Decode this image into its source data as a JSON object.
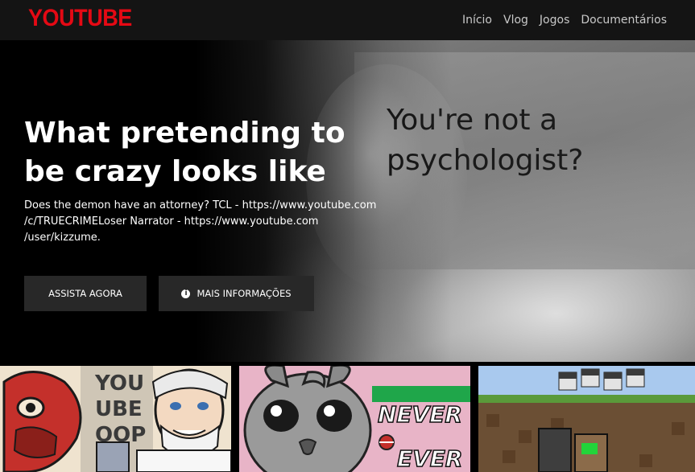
{
  "brand": {
    "logo": "YOUTUBE",
    "color": "#e50914"
  },
  "nav": {
    "links": [
      {
        "label": "Início"
      },
      {
        "label": "Vlog"
      },
      {
        "label": "Jogos"
      },
      {
        "label": "Documentários"
      }
    ]
  },
  "hero": {
    "title": "What pretending to be crazy looks like",
    "description": "Does the demon have an attorney? TCL - https://www.youtube.com\n/c/TRUECRIMELoser Narrator - https://www.youtube.com\n/user/kizzume.",
    "image_caption": "You're not a\npsychologist?",
    "watch_label": "ASSISTA AGORA",
    "info_label": "MAIS INFORMAÇÕES",
    "info_icon": "info-circle-icon"
  },
  "thumbnails": [
    {
      "text_lines": [
        "YOU",
        "UBE",
        "OOP"
      ]
    },
    {
      "text_lines": [
        "NEVER",
        "EVER"
      ]
    },
    {
      "text_lines": []
    }
  ]
}
